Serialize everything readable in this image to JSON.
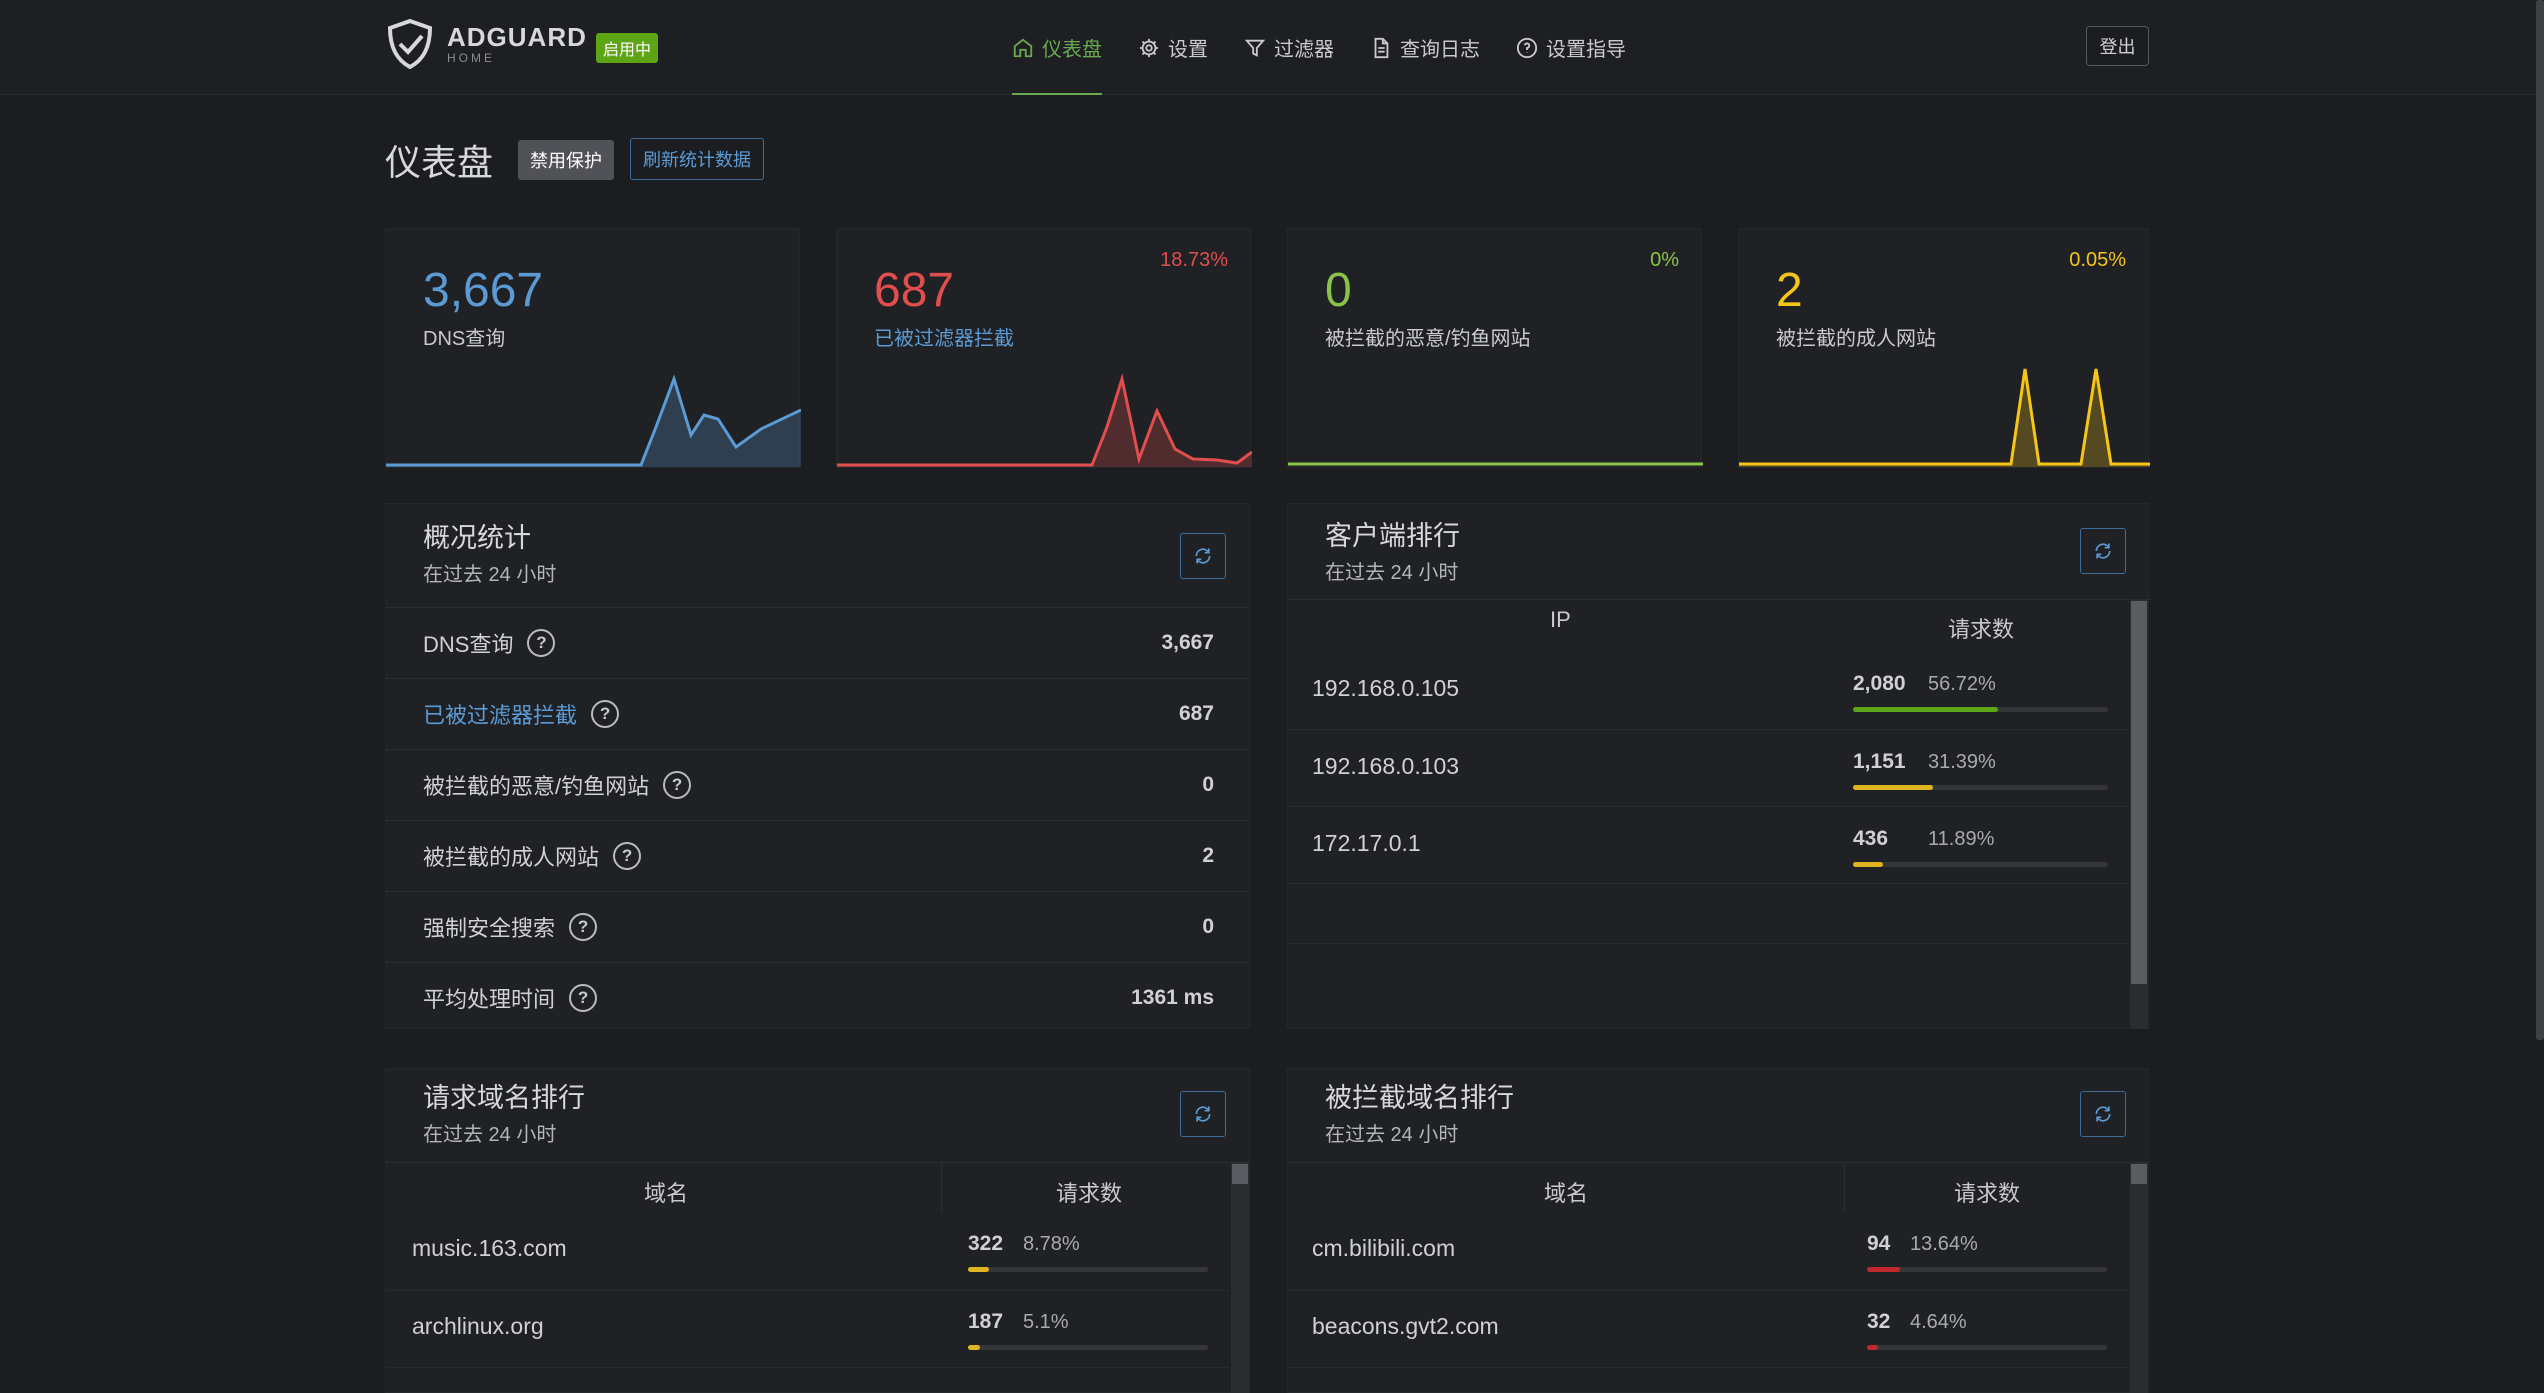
{
  "header": {
    "brand": "ADGUARD",
    "brand_sub": "HOME",
    "status_badge": "启用中",
    "nav": [
      {
        "label": "仪表盘",
        "icon": "home-icon",
        "active": true
      },
      {
        "label": "设置",
        "icon": "gear-icon",
        "active": false
      },
      {
        "label": "过滤器",
        "icon": "filter-icon",
        "active": false
      },
      {
        "label": "查询日志",
        "icon": "document-icon",
        "active": false
      },
      {
        "label": "设置指导",
        "icon": "help-circle-icon",
        "active": false
      }
    ],
    "logout": "登出"
  },
  "page": {
    "title": "仪表盘",
    "disable_protection": "禁用保护",
    "refresh_stats": "刷新统计数据"
  },
  "stats": [
    {
      "value": "3,667",
      "label": "DNS查询",
      "percent": "",
      "color": "#5b9bd5",
      "label_color": "#c9cacd"
    },
    {
      "value": "687",
      "label": "已被过滤器拦截",
      "percent": "18.73%",
      "color": "#e04e4e",
      "label_color": "#5b9bd5"
    },
    {
      "value": "0",
      "label": "被拦截的恶意/钓鱼网站",
      "percent": "0%",
      "color": "#8bc34a",
      "label_color": "#c9cacd"
    },
    {
      "value": "2",
      "label": "被拦截的成人网站",
      "percent": "0.05%",
      "color": "#f5c518",
      "label_color": "#c9cacd"
    }
  ],
  "overview": {
    "title": "概况统计",
    "subtitle": "在过去 24 小时",
    "rows": [
      {
        "label": "DNS查询",
        "value": "3,667",
        "link": false
      },
      {
        "label": "已被过滤器拦截",
        "value": "687",
        "link": true
      },
      {
        "label": "被拦截的恶意/钓鱼网站",
        "value": "0",
        "link": false
      },
      {
        "label": "被拦截的成人网站",
        "value": "2",
        "link": false
      },
      {
        "label": "强制安全搜索",
        "value": "0",
        "link": false
      },
      {
        "label": "平均处理时间",
        "value": "1361 ms",
        "link": false
      }
    ]
  },
  "clients": {
    "title": "客户端排行",
    "subtitle": "在过去 24 小时",
    "col_ip": "IP",
    "col_count": "请求数",
    "rows": [
      {
        "name": "192.168.0.105",
        "count": "2,080",
        "percent": "56.72%",
        "fraction": 0.5672,
        "color": "#5da515"
      },
      {
        "name": "192.168.0.103",
        "count": "1,151",
        "percent": "31.39%",
        "fraction": 0.3139,
        "color": "#e0b420"
      },
      {
        "name": "172.17.0.1",
        "count": "436",
        "percent": "11.89%",
        "fraction": 0.1189,
        "color": "#e0b420"
      }
    ]
  },
  "top_domains": {
    "title": "请求域名排行",
    "subtitle": "在过去 24 小时",
    "col_domain": "域名",
    "col_count": "请求数",
    "rows": [
      {
        "name": "music.163.com",
        "count": "322",
        "percent": "8.78%",
        "fraction": 0.0878,
        "color": "#e0b420"
      },
      {
        "name": "archlinux.org",
        "count": "187",
        "percent": "5.1%",
        "fraction": 0.051,
        "color": "#e0b420"
      }
    ]
  },
  "blocked_domains": {
    "title": "被拦截域名排行",
    "subtitle": "在过去 24 小时",
    "col_domain": "域名",
    "col_count": "请求数",
    "rows": [
      {
        "name": "cm.bilibili.com",
        "count": "94",
        "percent": "13.64%",
        "fraction": 0.1364,
        "color": "#c0282d"
      },
      {
        "name": "beacons.gvt2.com",
        "count": "32",
        "percent": "4.64%",
        "fraction": 0.0464,
        "color": "#c0282d"
      }
    ]
  }
}
